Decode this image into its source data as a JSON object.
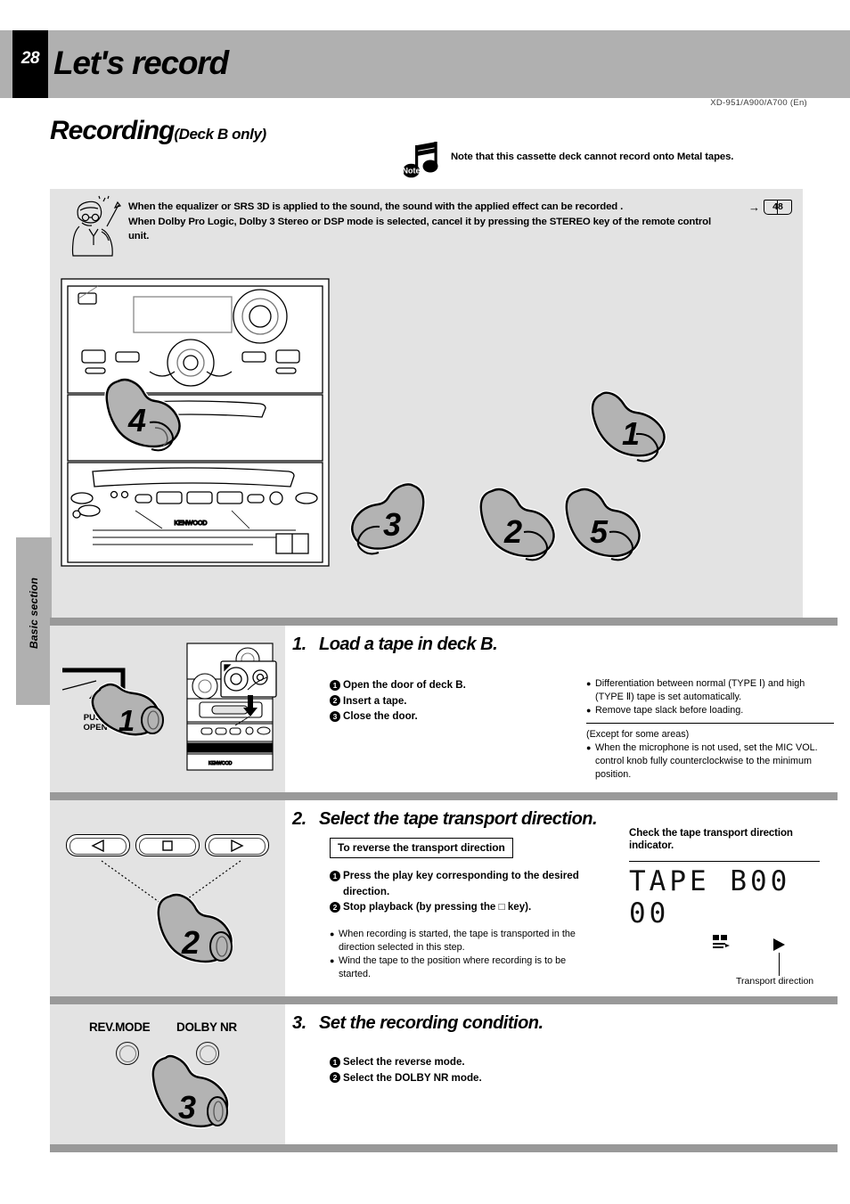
{
  "header": {
    "page_number": "28",
    "title": "Let's record",
    "model_line": "XD-951/A900/A700 (En)"
  },
  "section": {
    "heading": "Recording",
    "heading_sub": "(Deck B only)"
  },
  "note": {
    "icon": "music-note-icon",
    "badge": "Note",
    "text": "Note that this cassette deck cannot record onto Metal tapes."
  },
  "notice": {
    "icon": "professor-icon",
    "line1": "When the equalizer or SRS 3D is applied to the sound, the sound with the applied effect can be recorded .",
    "line2": "When Dolby Pro Logic, Dolby 3 Stereo or DSP mode is selected, cancel it by pressing the STEREO key of the remote control",
    "line3": "unit.",
    "reference": {
      "arrow": "→",
      "page": "48"
    }
  },
  "illustration": {
    "remote_brand": "KENWOOD",
    "system_brand": "KENWOOD",
    "callouts": [
      "4",
      "1",
      "3",
      "2",
      "5"
    ]
  },
  "side_tab": {
    "label": "Basic section"
  },
  "steps": [
    {
      "number": "1.",
      "title": "Load a tape in deck B.",
      "numbered": [
        "Open the door of deck B.",
        "Insert a tape.",
        "Close the door."
      ],
      "bullets": [
        "Differentiation between normal (TYPE Ⅰ) and high (TYPE Ⅱ) tape is set automatically.",
        "Remove tape slack before loading."
      ],
      "note_head": "(Except for some areas)",
      "note_bullets": [
        "When the microphone is not used, set the MIC VOL. control knob fully counterclockwise to the minimum position."
      ],
      "illustration": {
        "callout": "1",
        "push_open_line1": "PUSH",
        "push_open_line2": "OPEN",
        "eject_icon": "eject-icon"
      }
    },
    {
      "number": "2.",
      "title": "Select the tape transport direction.",
      "boxed_label": "To reverse the transport direction",
      "numbered": [
        "Press the play key corresponding to the desired direction.",
        "Stop playback (by pressing the □ key)."
      ],
      "bullets": [
        "When recording is started, the tape is transported in the direction selected in this step.",
        "Wind the tape to the position where recording is to be started."
      ],
      "indicator": {
        "head": "Check the tape transport direction indicator.",
        "display_text": "TAPE  B00 00",
        "caption": "Transport direction"
      },
      "illustration": {
        "callout": "2",
        "keys": [
          "play-reverse-key",
          "stop-key",
          "play-forward-key"
        ]
      }
    },
    {
      "number": "3.",
      "title": "Set the recording condition.",
      "numbered": [
        "Select the reverse mode.",
        "Select the DOLBY NR mode."
      ],
      "illustration": {
        "callout": "3",
        "knob_labels": [
          "REV.MODE",
          "DOLBY NR"
        ]
      }
    }
  ],
  "colors": {
    "header_band": "#b0b0b0",
    "panel_bg": "#e3e3e3",
    "divider": "#999999",
    "hand_fill": "#b3b3b3"
  }
}
